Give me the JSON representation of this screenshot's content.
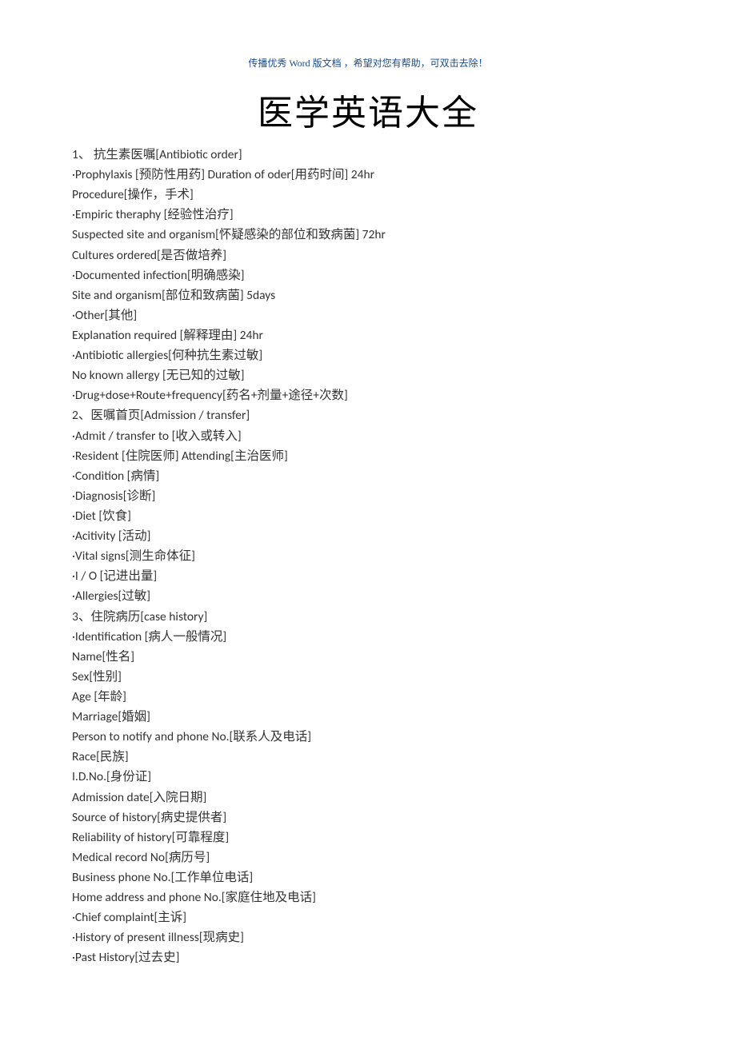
{
  "header_note": "传播优秀 Word 版文档 ，希望对您有帮助，可双击去除！",
  "title": "医学英语大全",
  "lines": [
    "1、 抗生素医嘱[Antibiotic order]",
    "·Prophylaxis [预防性用药] Duration of oder[用药时间] 24hr",
    "Procedure[操作，手术]",
    "·Empiric theraphy [经验性治疗]",
    "Suspected site and organism[怀疑感染的部位和致病菌] 72hr",
    "Cultures ordered[是否做培养]",
    "·Documented infection[明确感染]",
    "Site and organism[部位和致病菌] 5days",
    "·Other[其他]",
    "Explanation required [解释理由] 24hr",
    "·Antibiotic allergies[何种抗生素过敏]",
    "No known allergy [无已知的过敏]",
    "·Drug+dose+Route+frequency[药名+剂量+途径+次数]",
    "2、医嘱首页[Admission / transfer]",
    "·Admit / transfer to [收入或转入]",
    "·Resident [住院医师] Attending[主治医师]",
    "·Condition [病情]",
    "·Diagnosis[诊断]",
    "·Diet [饮食]",
    "·Acitivity [活动]",
    "·Vital signs[测生命体征]",
    "·I / O [记进出量]",
    "·Allergies[过敏]",
    "3、住院病历[case history]",
    "·Identification [病人一般情况]",
    "Name[性名]",
    "Sex[性别]",
    "Age [年龄]",
    "Marriage[婚姻]",
    "Person to notify and phone No.[联系人及电话]",
    "Race[民族]",
    "I.D.No.[身份证]",
    "Admission date[入院日期]",
    "Source of history[病史提供者]",
    "Reliability of history[可靠程度]",
    "Medical record No[病历号]",
    "Business phone No.[工作单位电话]",
    "Home address and phone No.[家庭住地及电话]",
    "·Chief complaint[主诉]",
    "·History of present illness[现病史]",
    "·Past History[过去史]"
  ]
}
